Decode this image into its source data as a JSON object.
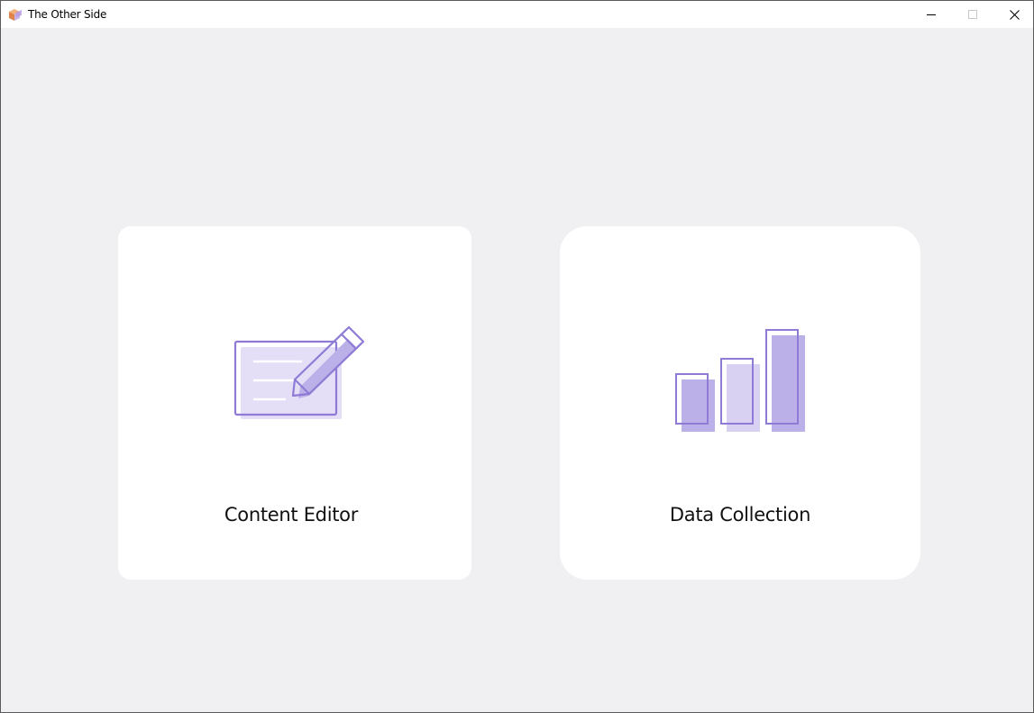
{
  "window": {
    "title": "The Other Side",
    "app_icon": "cube-icon",
    "controls": {
      "minimize": "minimize-icon",
      "maximize": "maximize-icon",
      "close": "close-icon"
    }
  },
  "cards": [
    {
      "label": "Content Editor",
      "icon": "edit-document-icon"
    },
    {
      "label": "Data Collection",
      "icon": "bar-chart-icon"
    }
  ],
  "colors": {
    "accent_stroke": "#8f7bd6",
    "accent_fill": "#bcb0e8",
    "accent_light": "#e4dff6",
    "background": "#f0f0f2",
    "card": "#ffffff"
  }
}
